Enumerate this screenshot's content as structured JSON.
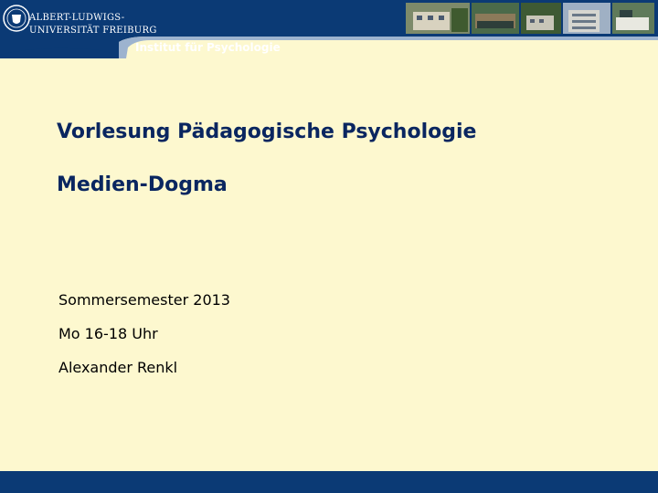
{
  "header": {
    "university_line1": "ALBERT-LUDWIGS-",
    "university_line2": "UNIVERSITÄT FREIBURG",
    "institute": "Institut für Psychologie",
    "colors": {
      "navy": "#0b3a75",
      "accent": "#9db3cf"
    }
  },
  "slide": {
    "title": "Vorlesung Pädagogische Psychologie",
    "subtitle": "Medien-Dogma",
    "semester": "Sommersemester 2013",
    "time": "Mo 16-18 Uhr",
    "lecturer": "Alexander Renkl",
    "title_color": "#0a2660",
    "background": "#fdf8cf"
  }
}
